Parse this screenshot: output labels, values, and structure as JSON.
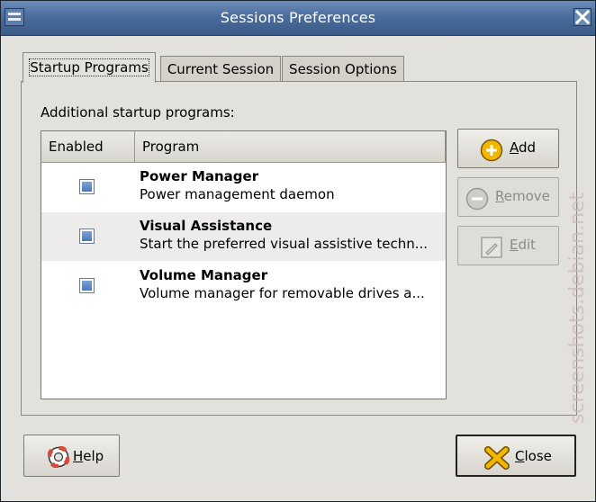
{
  "window": {
    "title": "Sessions Preferences"
  },
  "tabs": [
    {
      "label": "Startup Programs",
      "active": true
    },
    {
      "label": "Current Session",
      "active": false
    },
    {
      "label": "Session Options",
      "active": false
    }
  ],
  "startup": {
    "heading": "Additional startup programs:",
    "columns": {
      "enabled": "Enabled",
      "program": "Program"
    },
    "rows": [
      {
        "enabled": true,
        "name": "Power Manager",
        "description": "Power management daemon"
      },
      {
        "enabled": true,
        "name": "Visual Assistance",
        "description": "Start the preferred visual assistive techn..."
      },
      {
        "enabled": true,
        "name": "Volume Manager",
        "description": "Volume manager for removable drives a..."
      }
    ]
  },
  "buttons": {
    "add": {
      "label": "dd",
      "mnemonic": "A",
      "icon": "add-icon"
    },
    "remove": {
      "label": "emove",
      "mnemonic": "R",
      "icon": "remove-icon"
    },
    "edit": {
      "label": "dit",
      "mnemonic": "E",
      "icon": "edit-icon"
    },
    "help": {
      "label": "elp",
      "mnemonic": "H",
      "icon": "help-icon"
    },
    "close": {
      "label": "lose",
      "mnemonic": "C",
      "icon": "close-icon"
    }
  },
  "watermark": {
    "text": "screenshots.debian.net"
  },
  "colors": {
    "titlebar": "#4b6d9c",
    "accent_check": "#4a78b8",
    "add_icon": "#e8a800",
    "close_icon": "#f0b400",
    "help_icon": "#d84a3a"
  }
}
